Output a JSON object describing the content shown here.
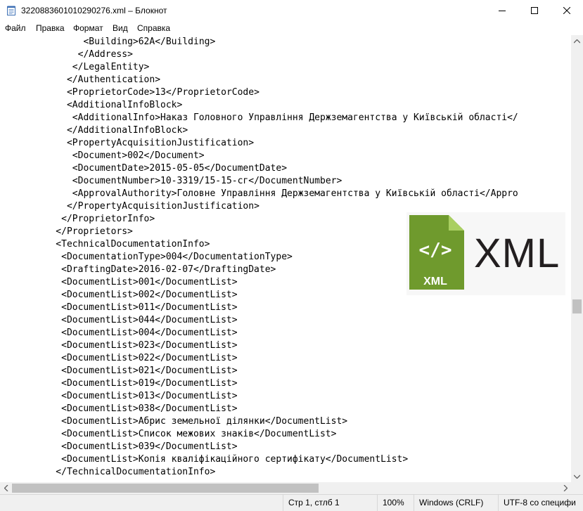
{
  "window": {
    "title": "3220883601010290276.xml – Блокнот"
  },
  "menu": {
    "items": [
      "Файл",
      "Правка",
      "Формат",
      "Вид",
      "Справка"
    ]
  },
  "editor": {
    "lines": [
      {
        "indent": 12,
        "text": "<Building>62A</Building>"
      },
      {
        "indent": 11,
        "text": "</Address>"
      },
      {
        "indent": 10,
        "text": "</LegalEntity>"
      },
      {
        "indent": 9,
        "text": "</Authentication>"
      },
      {
        "indent": 9,
        "text": "<ProprietorCode>13</ProprietorCode>"
      },
      {
        "indent": 9,
        "text": "<AdditionalInfoBlock>"
      },
      {
        "indent": 10,
        "text": "<AdditionalInfo>Наказ Головного Управління Держземагентства у Київській області</"
      },
      {
        "indent": 9,
        "text": "</AdditionalInfoBlock>"
      },
      {
        "indent": 9,
        "text": "<PropertyAcquisitionJustification>"
      },
      {
        "indent": 10,
        "text": "<Document>002</Document>"
      },
      {
        "indent": 10,
        "text": "<DocumentDate>2015-05-05</DocumentDate>"
      },
      {
        "indent": 10,
        "text": "<DocumentNumber>10-3319/15-15-сг</DocumentNumber>"
      },
      {
        "indent": 10,
        "text": "<ApprovalAuthority>Головне Управління Держземагентства у Київській області</Appro"
      },
      {
        "indent": 9,
        "text": "</PropertyAcquisitionJustification>"
      },
      {
        "indent": 8,
        "text": "</ProprietorInfo>"
      },
      {
        "indent": 7,
        "text": "</Proprietors>"
      },
      {
        "indent": 7,
        "text": "<TechnicalDocumentationInfo>"
      },
      {
        "indent": 8,
        "text": "<DocumentationType>004</DocumentationType>"
      },
      {
        "indent": 8,
        "text": "<DraftingDate>2016-02-07</DraftingDate>"
      },
      {
        "indent": 8,
        "text": "<DocumentList>001</DocumentList>"
      },
      {
        "indent": 8,
        "text": "<DocumentList>002</DocumentList>"
      },
      {
        "indent": 8,
        "text": "<DocumentList>011</DocumentList>"
      },
      {
        "indent": 8,
        "text": "<DocumentList>044</DocumentList>"
      },
      {
        "indent": 8,
        "text": "<DocumentList>004</DocumentList>"
      },
      {
        "indent": 8,
        "text": "<DocumentList>023</DocumentList>"
      },
      {
        "indent": 8,
        "text": "<DocumentList>022</DocumentList>"
      },
      {
        "indent": 8,
        "text": "<DocumentList>021</DocumentList>"
      },
      {
        "indent": 8,
        "text": "<DocumentList>019</DocumentList>"
      },
      {
        "indent": 8,
        "text": "<DocumentList>013</DocumentList>"
      },
      {
        "indent": 8,
        "text": "<DocumentList>038</DocumentList>"
      },
      {
        "indent": 8,
        "text": "<DocumentList>Абрис земельної ділянки</DocumentList>"
      },
      {
        "indent": 8,
        "text": "<DocumentList>Список межових знаків</DocumentList>"
      },
      {
        "indent": 8,
        "text": "<DocumentList>039</DocumentList>"
      },
      {
        "indent": 8,
        "text": "<DocumentList>Копія кваліфікаційного сертифікату</DocumentList>"
      },
      {
        "indent": 7,
        "text": "</TechnicalDocumentationInfo>"
      }
    ]
  },
  "overlay_logo": {
    "badge_text": "XML",
    "code_glyph": "</>",
    "wordmark": "XML",
    "badge_color": "#6f9a2d",
    "badge_fold_color": "#a9cf61"
  },
  "statusbar": {
    "position": "Стр 1, стлб 1",
    "zoom": "100%",
    "line_endings": "Windows (CRLF)",
    "encoding": "UTF-8 со специфи"
  },
  "icons": {
    "app": "notepad-icon",
    "minimize": "minimize-icon",
    "maximize": "maximize-icon",
    "close": "close-icon"
  }
}
